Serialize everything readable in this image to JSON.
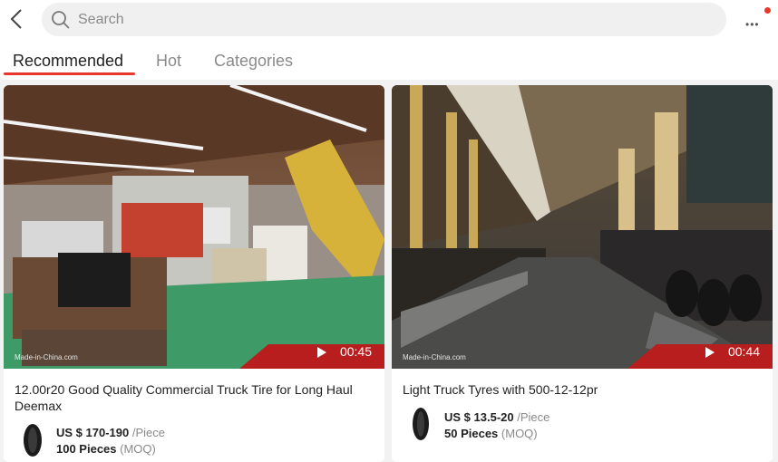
{
  "search": {
    "placeholder": "Search"
  },
  "tabs": [
    {
      "label": "Recommended",
      "active": true
    },
    {
      "label": "Hot",
      "active": false
    },
    {
      "label": "Categories",
      "active": false
    }
  ],
  "products": [
    {
      "duration": "00:45",
      "watermark": "Made-in-China.com",
      "title": "12.00r20 Good Quality Commercial Truck Tire for Long Haul Deemax",
      "price": "US $ 170-190",
      "price_unit": "/Piece",
      "moq": "100 Pieces",
      "moq_unit": "(MOQ)"
    },
    {
      "duration": "00:44",
      "watermark": "Made-in-China.com",
      "title": "Light Truck Tyres with 500-12-12pr",
      "price": "US $ 13.5-20",
      "price_unit": "/Piece",
      "moq": "50 Pieces",
      "moq_unit": "(MOQ)"
    }
  ],
  "colors": {
    "accent": "#e8372d",
    "text": "#222222",
    "muted": "#8a8a8a"
  },
  "icons": [
    "back-arrow-icon",
    "search-icon",
    "more-icon",
    "play-icon",
    "tire-icon"
  ]
}
